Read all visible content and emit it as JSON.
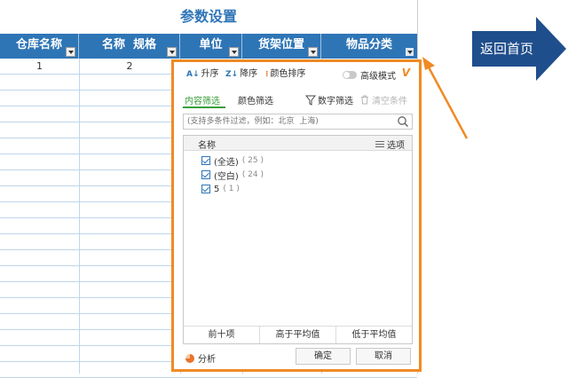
{
  "sheet": {
    "title": "参数设置",
    "columns": [
      "仓库名称",
      "名称  规格",
      "单位",
      "货架位置",
      "物品分类"
    ],
    "first_row": [
      "1",
      "2",
      "",
      "",
      ""
    ],
    "empty_row_count": 19
  },
  "filter_popup": {
    "sort_asc": "升序",
    "sort_desc": "降序",
    "color_sort": "颜色排序",
    "advanced_mode": "高级模式",
    "vip_badge": "V",
    "tabs": {
      "content": "内容筛选",
      "color": "颜色筛选"
    },
    "number_filter": "数字筛选",
    "clear_conditions": "清空条件",
    "search_placeholder": "(支持多条件过滤，例如：北京  上海)",
    "list_header": "名称",
    "options_label": "选项",
    "items": [
      {
        "label": "(全选)",
        "count": "( 25 )",
        "checked": true
      },
      {
        "label": "(空白)",
        "count": "( 24 )",
        "checked": true
      },
      {
        "label": "5",
        "count": "( 1 )",
        "checked": true
      }
    ],
    "quick_filters": [
      "前十项",
      "高于平均值",
      "低于平均值"
    ],
    "analysis_label": "分析",
    "ok_label": "确定",
    "cancel_label": "取消"
  },
  "return_nav": {
    "label": "返回首页"
  },
  "colors": {
    "header_blue": "#2E75B6",
    "callout_orange": "#F08A24",
    "nav_arrow": "#1F4E8C"
  }
}
